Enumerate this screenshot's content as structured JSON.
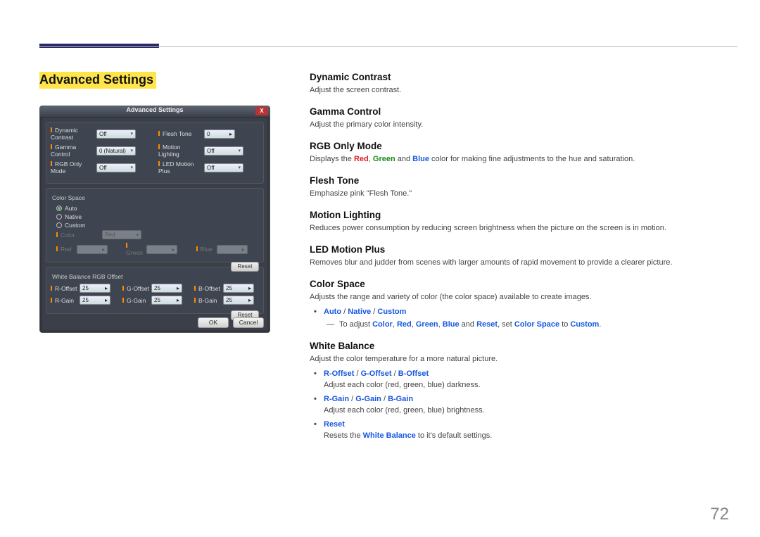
{
  "page_number": "72",
  "section_title": "Advanced Settings",
  "dialog": {
    "title": "Advanced Settings",
    "close_x": "X",
    "rows": {
      "dynamic_contrast": {
        "label": "Dynamic Contrast",
        "value": "Off"
      },
      "flesh_tone": {
        "label": "Flesh Tone",
        "value": "0"
      },
      "gamma_control": {
        "label": "Gamma Control",
        "value": "0 (Natural)"
      },
      "motion_lighting": {
        "label": "Motion Lighting",
        "value": "Off"
      },
      "rgb_only": {
        "label": "RGB Only Mode",
        "value": "Off"
      },
      "led_motion_plus": {
        "label": "LED Motion Plus",
        "value": "Off"
      }
    },
    "color_space": {
      "title": "Color Space",
      "auto": "Auto",
      "native": "Native",
      "custom": "Custom",
      "color_label": "Color",
      "color_value": "Red",
      "red": "Red",
      "green": "Green",
      "blue": "Blue",
      "reset": "Reset"
    },
    "white_balance": {
      "title": "White Balance RGB Offset",
      "r_offset": {
        "label": "R-Offset",
        "value": "25"
      },
      "g_offset": {
        "label": "G-Offset",
        "value": "25"
      },
      "b_offset": {
        "label": "B-Offset",
        "value": "25"
      },
      "r_gain": {
        "label": "R-Gain",
        "value": "25"
      },
      "g_gain": {
        "label": "G-Gain",
        "value": "25"
      },
      "b_gain": {
        "label": "B-Gain",
        "value": "25"
      },
      "reset": "Reset"
    },
    "ok": "OK",
    "cancel": "Cancel"
  },
  "desc": {
    "dynamic_contrast": {
      "h": "Dynamic Contrast",
      "p": "Adjust the screen contrast."
    },
    "gamma_control": {
      "h": "Gamma Control",
      "p": "Adjust the primary color intensity."
    },
    "rgb_only": {
      "h": "RGB Only Mode",
      "pre": "Displays the ",
      "red": "Red",
      "c1": ", ",
      "green": "Green",
      "c2": " and ",
      "blue": "Blue",
      "post": " color for making fine adjustments to the hue and saturation."
    },
    "flesh_tone": {
      "h": "Flesh Tone",
      "p": "Emphasize pink \"Flesh Tone.\""
    },
    "motion_lighting": {
      "h": "Motion Lighting",
      "p": "Reduces power consumption by reducing screen brightness when the picture on the screen is in motion."
    },
    "led_motion_plus": {
      "h": "LED Motion Plus",
      "p": "Removes blur and judder from scenes with larger amounts of rapid movement to provide a clearer picture."
    },
    "color_space": {
      "h": "Color Space",
      "p": "Adjusts the range and variety of color (the color space) available to create images.",
      "auto": "Auto",
      "s1": " / ",
      "native": "Native",
      "s2": " / ",
      "custom": "Custom",
      "sub_pre": "To adjust ",
      "color": "Color",
      "c1": ", ",
      "red": "Red",
      "c2": ", ",
      "green": "Green",
      "c3": ", ",
      "blue": "Blue",
      "c4": " and ",
      "reset": "Reset",
      "c5": ", set ",
      "cs": "Color Space",
      "c6": " to ",
      "custom2": "Custom",
      "dot": "."
    },
    "white_balance": {
      "h": "White Balance",
      "p": "Adjust the color temperature for a more natural picture.",
      "b1": {
        "ro": "R-Offset",
        "s": " / ",
        "go": "G-Offset",
        "s2": " / ",
        "bo": "B-Offset",
        "txt": "Adjust each color (red, green, blue) darkness."
      },
      "b2": {
        "rg": "R-Gain",
        "s": " / ",
        "gg": "G-Gain",
        "s2": " / ",
        "bg": "B-Gain",
        "txt": "Adjust each color (red, green, blue) brightness."
      },
      "b3": {
        "reset": "Reset",
        "pre": "Resets the ",
        "wb": "White Balance",
        "post": " to it's default settings."
      }
    }
  }
}
